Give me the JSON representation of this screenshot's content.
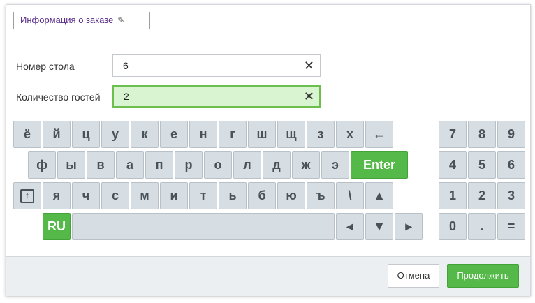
{
  "tab": {
    "label": "Информация о заказе",
    "icon": "pencil-icon"
  },
  "form": {
    "table_label": "Номер стола",
    "table_value": "6",
    "guests_label": "Количество гостей",
    "guests_value": "2",
    "clear_glyph": "✕"
  },
  "keyboard": {
    "row1": [
      "ё",
      "й",
      "ц",
      "у",
      "к",
      "е",
      "н",
      "г",
      "ш",
      "щ",
      "з",
      "х",
      "←"
    ],
    "row2": [
      "ф",
      "ы",
      "в",
      "а",
      "п",
      "р",
      "о",
      "л",
      "д",
      "ж",
      "э"
    ],
    "enter": "Enter",
    "row3": [
      "я",
      "ч",
      "с",
      "м",
      "и",
      "т",
      "ь",
      "б",
      "ю",
      "ъ",
      "\\",
      "▲"
    ],
    "lang": "RU",
    "arrows": [
      "◂",
      "▼",
      "▸"
    ],
    "numpad": [
      "7",
      "8",
      "9",
      "4",
      "5",
      "6",
      "1",
      "2",
      "3",
      "0",
      ".",
      "="
    ]
  },
  "footer": {
    "cancel": "Отмена",
    "continue": "Продолжить"
  },
  "colors": {
    "accent_green": "#54b948",
    "key_bg": "#d6dde3",
    "tab_text": "#5a2d8a"
  }
}
